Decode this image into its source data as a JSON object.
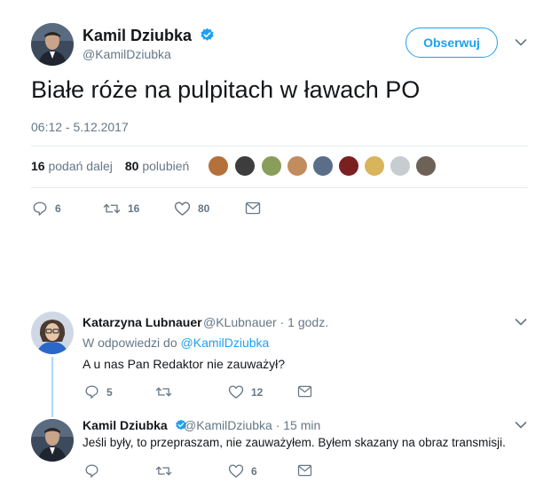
{
  "main_tweet": {
    "author_name": "Kamil Dziubka",
    "author_handle": "@KamilDziubka",
    "follow_label": "Obserwuj",
    "text": "Białe róże na pulpitach w ławach PO",
    "timestamp": "06:12 - 5.12.2017",
    "retweets_count": "16",
    "retweets_label": "podań dalej",
    "likes_count": "80",
    "likes_label": "polubień",
    "actions": {
      "replies": "6",
      "retweets": "16",
      "likes": "80"
    }
  },
  "replies": [
    {
      "author_name": "Katarzyna Lubnauer",
      "meta": "@KLubnauer · 1 godz.",
      "reply_to_prefix": "W odpowiedzi do",
      "reply_to_handle": "@KamilDziubka",
      "text": "A u nas Pan Redaktor nie zauważył?",
      "actions": {
        "replies": "5",
        "retweets": "",
        "likes": "12"
      }
    },
    {
      "author_name": "Kamil Dziubka",
      "meta": "@KamilDziubka · 15 min",
      "text": "Jeśli były, to przepraszam, nie zauważyłem. Byłem skazany na obraz transmisji.",
      "actions": {
        "replies": "",
        "retweets": "",
        "likes": "6"
      }
    }
  ],
  "colors": {
    "accent": "#1da1f2",
    "text": "#14171a",
    "muted": "#657786",
    "divider": "#e6ecf0",
    "thread_line": "#aad8f5"
  }
}
